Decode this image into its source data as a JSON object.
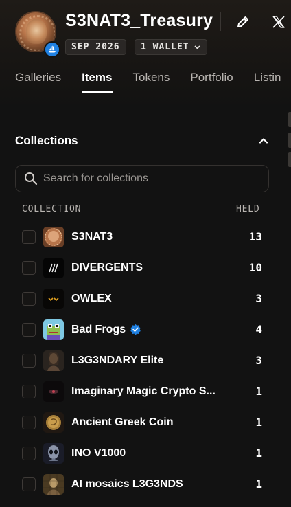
{
  "profile": {
    "name": "S3NAT3_Treasury",
    "joined": "SEP 2026",
    "wallets": "1 WALLET"
  },
  "tabs": [
    {
      "label": "Galleries",
      "active": false
    },
    {
      "label": "Items",
      "active": true
    },
    {
      "label": "Tokens",
      "active": false
    },
    {
      "label": "Portfolio",
      "active": false
    },
    {
      "label": "Listin",
      "active": false
    }
  ],
  "collections": {
    "title": "Collections",
    "search_placeholder": "Search for collections",
    "col_collection": "COLLECTION",
    "col_held": "HELD",
    "rows": [
      {
        "name": "S3NAT3",
        "held": "13",
        "verified": false,
        "thumb": "coin-bust"
      },
      {
        "name": "DIVERGENTS",
        "held": "10",
        "verified": false,
        "thumb": "slashes"
      },
      {
        "name": "OWLEX",
        "held": "3",
        "verified": false,
        "thumb": "owl-eyes"
      },
      {
        "name": "Bad Frogs",
        "held": "4",
        "verified": true,
        "thumb": "frog"
      },
      {
        "name": "L3G3NDARY Elite",
        "held": "3",
        "verified": false,
        "thumb": "portrait"
      },
      {
        "name": "Imaginary Magic Crypto S...",
        "held": "1",
        "verified": false,
        "thumb": "dark-eye"
      },
      {
        "name": "Ancient Greek Coin",
        "held": "1",
        "verified": false,
        "thumb": "gold-coin"
      },
      {
        "name": "INO V1000",
        "held": "1",
        "verified": false,
        "thumb": "alien"
      },
      {
        "name": "AI mosaics L3G3NDS",
        "held": "1",
        "verified": false,
        "thumb": "mosaic"
      }
    ]
  },
  "colors": {
    "background": "#121212",
    "accent": "#2081e2"
  }
}
